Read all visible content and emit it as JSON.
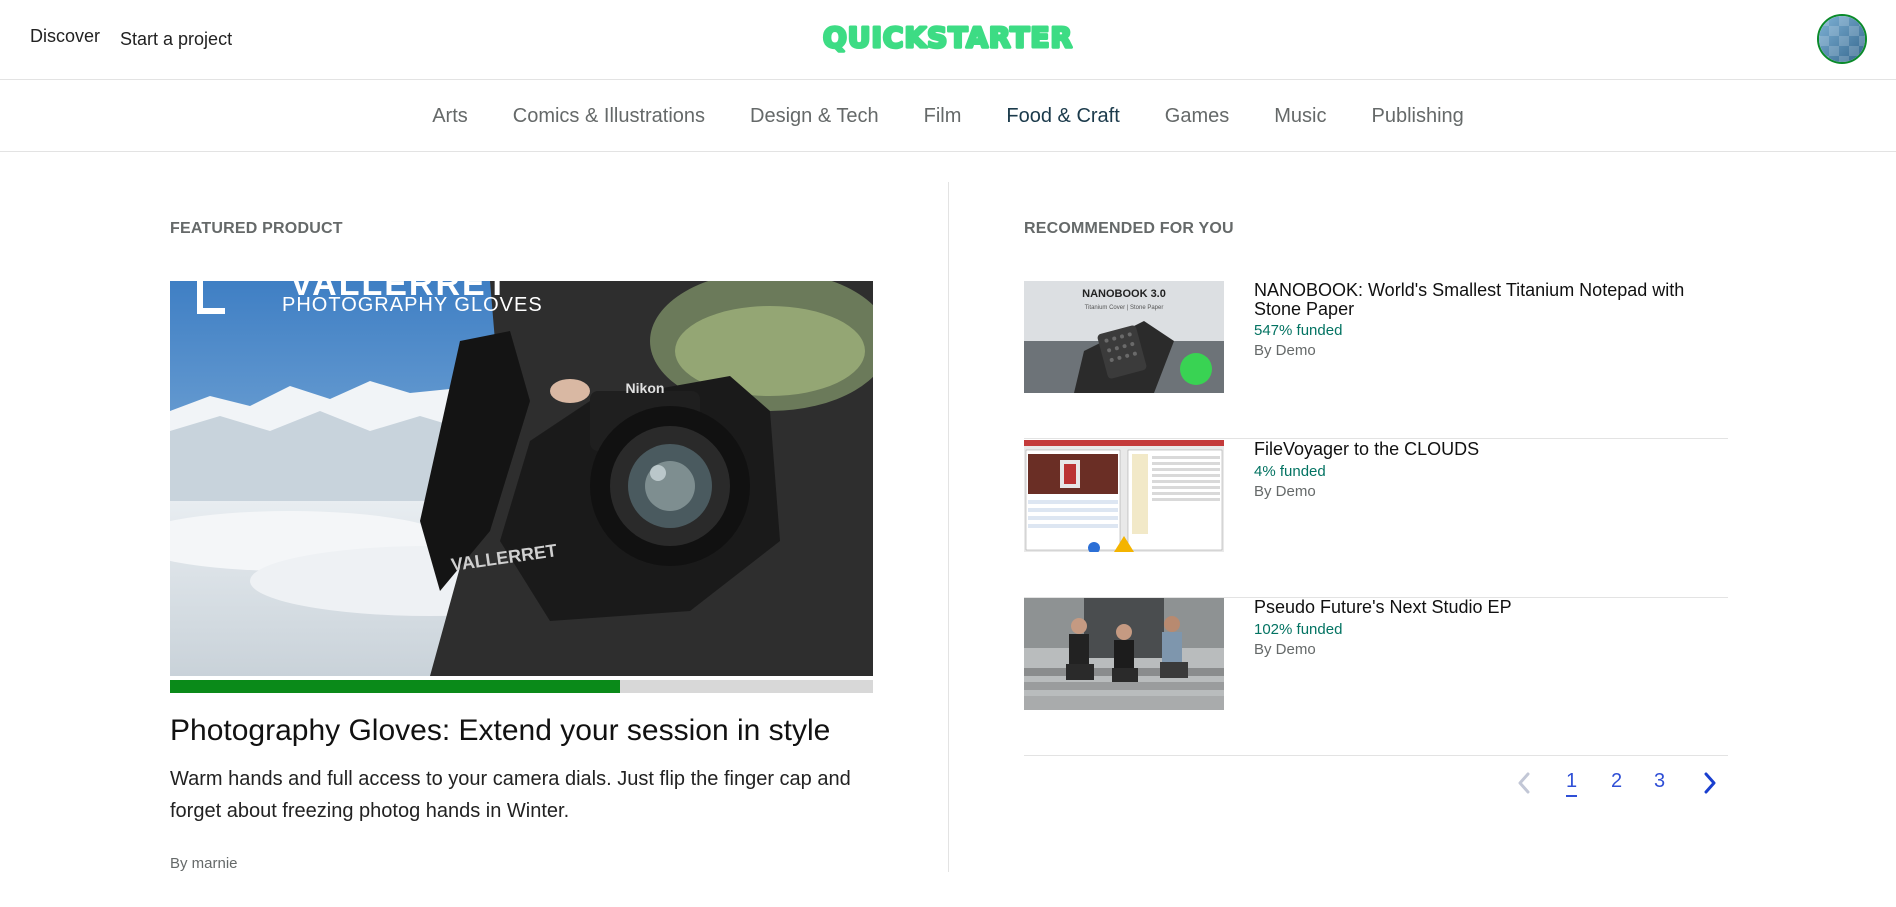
{
  "header": {
    "nav": [
      {
        "label": "Discover"
      },
      {
        "label": "Start a project"
      }
    ],
    "logo_text": "QUICKSTARTER",
    "brand_color": "#3ddc84"
  },
  "categories": [
    {
      "label": "Arts",
      "active": false
    },
    {
      "label": "Comics & Illustrations",
      "active": false
    },
    {
      "label": "Design & Tech",
      "active": false
    },
    {
      "label": "Film",
      "active": false
    },
    {
      "label": "Food & Craft",
      "active": true
    },
    {
      "label": "Games",
      "active": false
    },
    {
      "label": "Music",
      "active": false
    },
    {
      "label": "Publishing",
      "active": false
    }
  ],
  "featured": {
    "section_label": "FEATURED PRODUCT",
    "image_brand_text": "VALLERRET",
    "image_caption": "PHOTOGRAPHY GLOVES",
    "funding_progress_percent": 64,
    "title": "Photography Gloves: Extend your session in style",
    "description": "Warm hands and full access to your camera dials. Just flip the finger cap and forget about freezing photog hands in Winter.",
    "by": "By marnie"
  },
  "recommended": {
    "section_label": "RECOMMENDED FOR YOU",
    "items": [
      {
        "title": "NANOBOOK: World's Smallest Titanium Notepad with Stone Paper",
        "funded": "547% funded",
        "by": "By Demo",
        "thumb_text": "NANOBOOK 3.0",
        "thumb_sub": "Titanium Cover | Stone Paper"
      },
      {
        "title": "FileVoyager to the CLOUDS",
        "funded": "4% funded",
        "by": "By Demo"
      },
      {
        "title": "Pseudo Future's Next Studio EP",
        "funded": "102% funded",
        "by": "By Demo"
      }
    ]
  },
  "pagination": {
    "pages": [
      "1",
      "2",
      "3"
    ],
    "current": "1",
    "prev_icon": "chevron-left-icon",
    "next_icon": "chevron-right-icon"
  }
}
